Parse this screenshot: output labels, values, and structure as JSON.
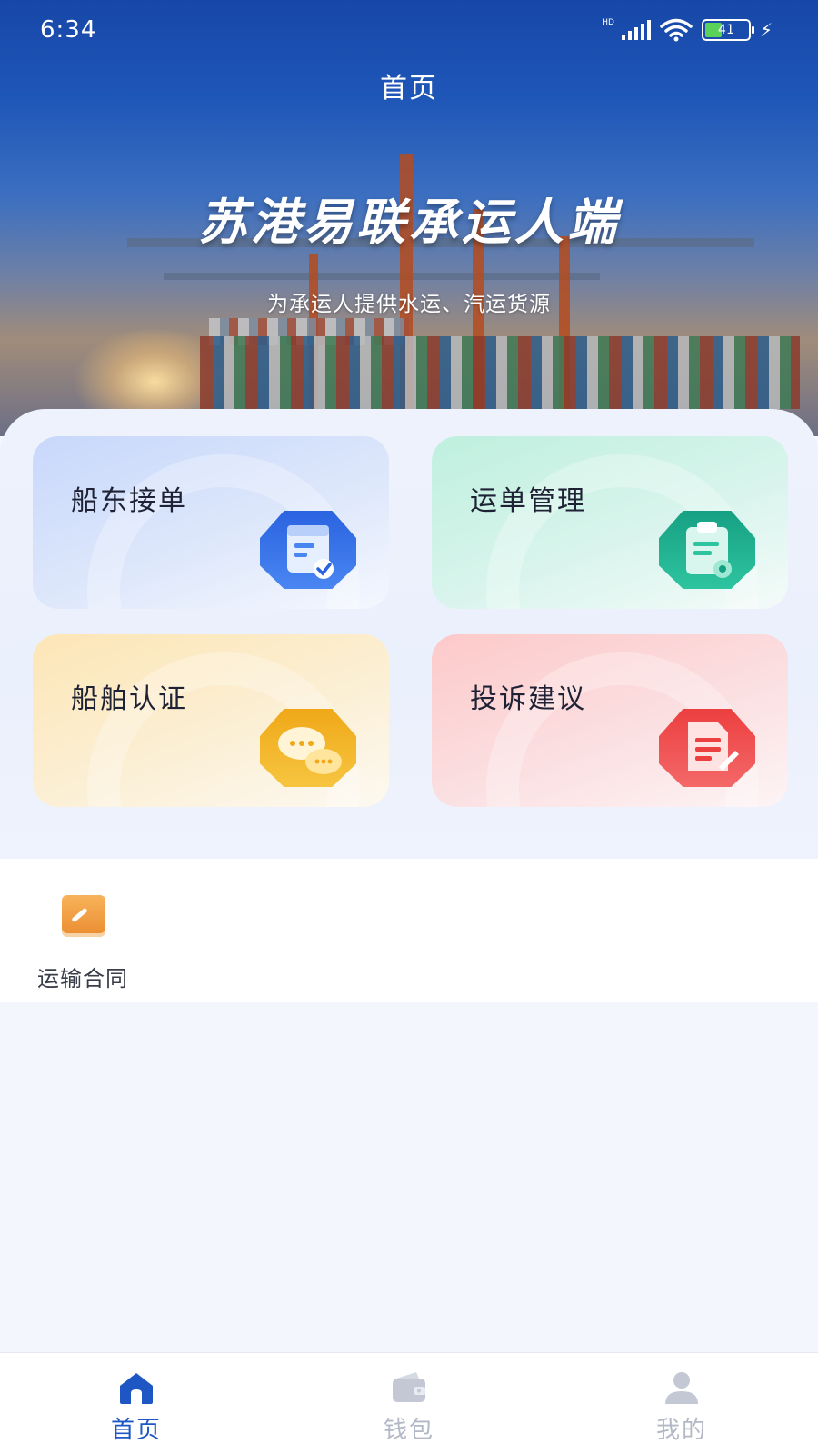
{
  "status_bar": {
    "time": "6:34",
    "network_label": "HD",
    "battery_level": "41",
    "icons": [
      "signal-icon",
      "wifi-icon",
      "battery-icon",
      "charging-icon"
    ]
  },
  "header": {
    "title": "首页"
  },
  "hero": {
    "title": "苏港易联承运人端",
    "subtitle": "为承运人提供水运、汽运货源"
  },
  "cards": [
    {
      "label": "船东接单",
      "icon": "calendar-check-icon",
      "color": "#2f6fe8"
    },
    {
      "label": "运单管理",
      "icon": "clipboard-icon",
      "color": "#20a98a"
    },
    {
      "label": "船舶认证",
      "icon": "chat-bubbles-icon",
      "color": "#f2b21c"
    },
    {
      "label": "投诉建议",
      "icon": "document-edit-icon",
      "color": "#ef4a4a"
    }
  ],
  "contract": {
    "label": "运输合同",
    "icon": "pencil-icon",
    "color": "#f0a040"
  },
  "tabbar": {
    "items": [
      {
        "label": "首页",
        "icon": "home-icon",
        "active": true
      },
      {
        "label": "钱包",
        "icon": "wallet-icon",
        "active": false
      },
      {
        "label": "我的",
        "icon": "user-icon",
        "active": false
      }
    ],
    "active_color": "#1e57c4",
    "inactive_color": "#b3b8c6"
  }
}
